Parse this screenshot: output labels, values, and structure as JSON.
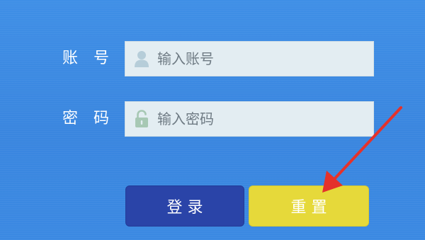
{
  "form": {
    "account_label": "账　号",
    "password_label": "密　码",
    "account_placeholder": "输入账号",
    "password_placeholder": "输入密码",
    "login_label": "登 录",
    "reset_label": "重 置"
  },
  "icons": {
    "account_field_icon": "user-icon",
    "password_field_icon": "unlock-icon",
    "annotation": "red-arrow-icon"
  },
  "colors": {
    "background": "#3b89e2",
    "field_bg": "#e3edf2",
    "login_button": "#2a44a8",
    "reset_button": "#e6d93a",
    "annotation_arrow": "#e4322b"
  }
}
